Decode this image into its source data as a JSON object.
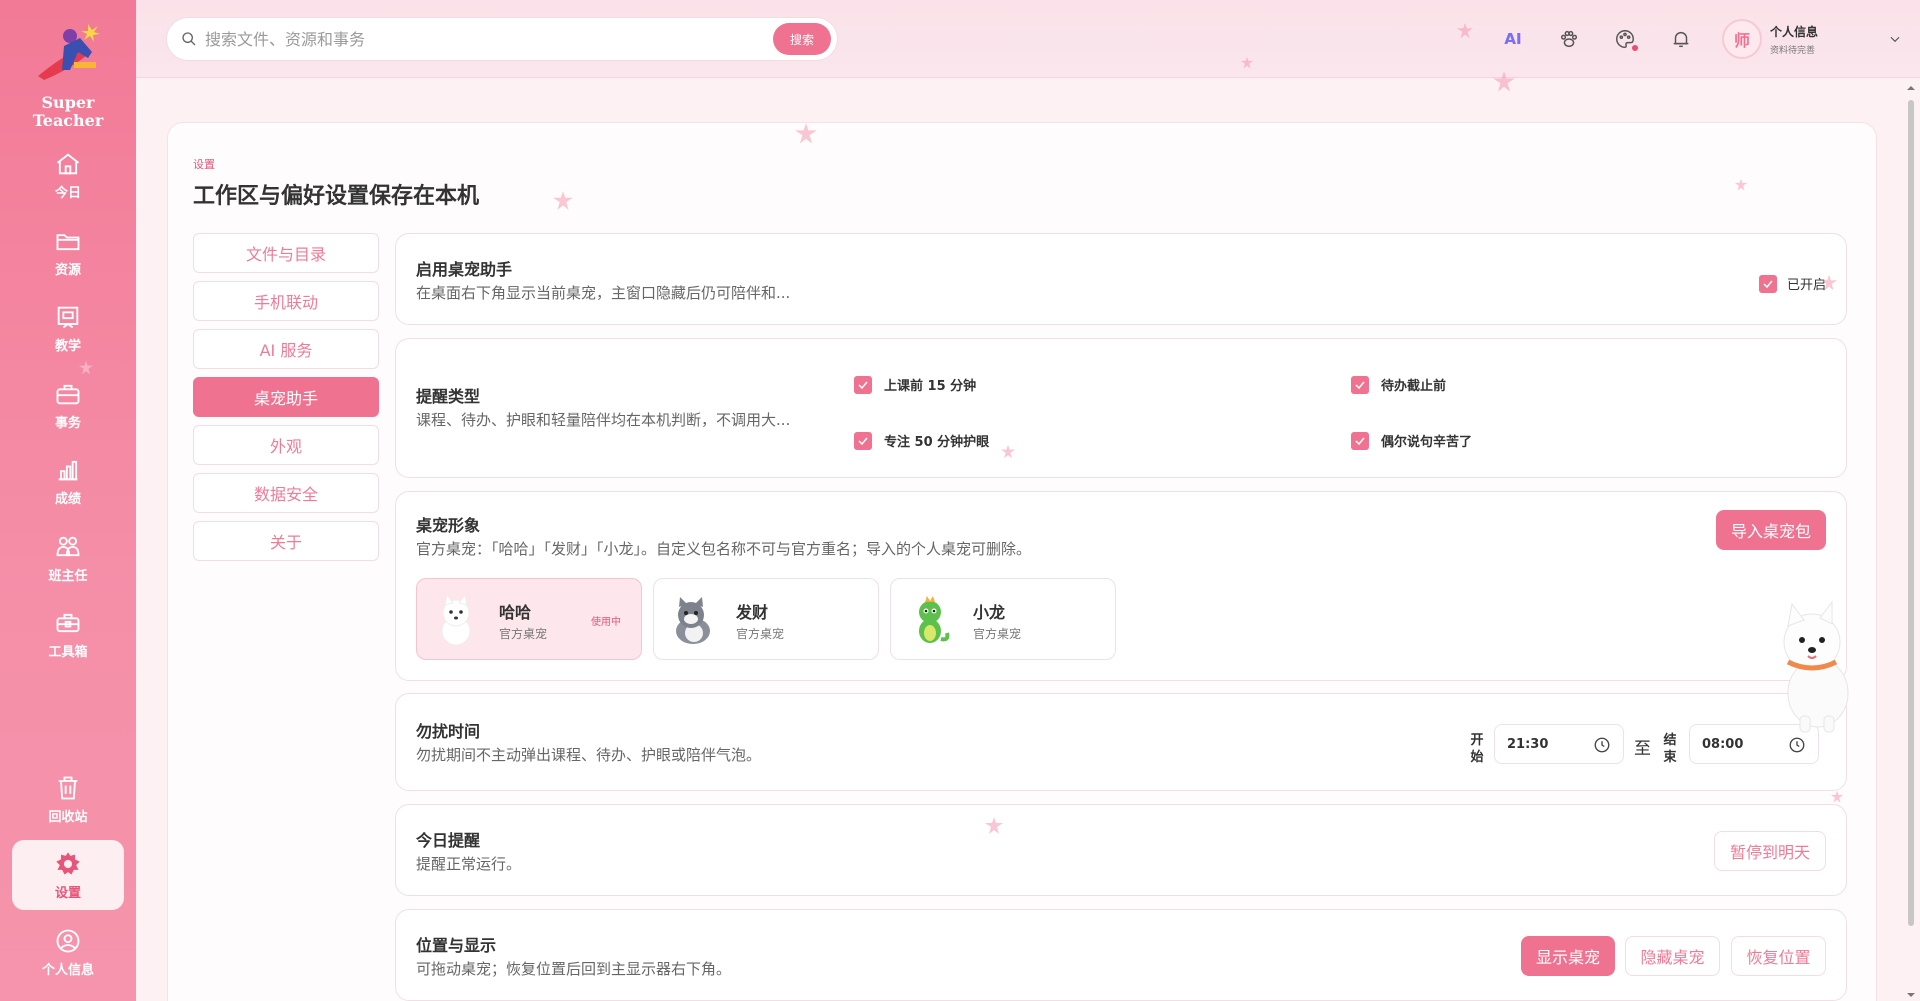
{
  "app": {
    "brand": "Super Teacher"
  },
  "sidebar": {
    "items": [
      {
        "label": "今日",
        "icon": "home-icon"
      },
      {
        "label": "资源",
        "icon": "folder-icon"
      },
      {
        "label": "教学",
        "icon": "teaching-icon"
      },
      {
        "label": "事务",
        "icon": "briefcase-icon"
      },
      {
        "label": "成绩",
        "icon": "bar-chart-icon"
      },
      {
        "label": "班主任",
        "icon": "group-icon"
      },
      {
        "label": "工具箱",
        "icon": "toolbox-icon"
      }
    ],
    "bottom": [
      {
        "label": "回收站",
        "icon": "trash-icon"
      },
      {
        "label": "设置",
        "icon": "gear-icon",
        "active": true
      },
      {
        "label": "个人信息",
        "icon": "user-icon"
      }
    ]
  },
  "topbar": {
    "search_placeholder": "搜索文件、资源和事务",
    "search_button": "搜索",
    "ai_label": "AI",
    "profile_avatar": "师",
    "profile_name": "个人信息",
    "profile_sub": "资料待完善"
  },
  "page": {
    "crumb": "设置",
    "title": "工作区与偏好设置保存在本机"
  },
  "subnav": {
    "items": [
      "文件与目录",
      "手机联动",
      "AI 服务",
      "桌宠助手",
      "外观",
      "数据安全",
      "关于"
    ],
    "active": "桌宠助手"
  },
  "sections": {
    "enable": {
      "title": "启用桌宠助手",
      "desc": "在桌面右下角显示当前桌宠，主窗口隐藏后仍可陪伴和...",
      "toggle_label": "已开启"
    },
    "reminders": {
      "title": "提醒类型",
      "desc": "课程、待办、护眼和轻量陪伴均在本机判断，不调用大...",
      "options": [
        "上课前 15 分钟",
        "待办截止前",
        "专注 50 分钟护眼",
        "偶尔说句辛苦了"
      ]
    },
    "appearance": {
      "title": "桌宠形象",
      "desc": "官方桌宠：「哈哈」「发财」「小龙」。自定义包名称不可与官方重名；导入的个人桌宠可删除。",
      "import_button": "导入桌宠包",
      "pets": [
        {
          "name": "哈哈",
          "sub": "官方桌宠",
          "badge": "使用中"
        },
        {
          "name": "发财",
          "sub": "官方桌宠",
          "badge": ""
        },
        {
          "name": "小龙",
          "sub": "官方桌宠",
          "badge": ""
        }
      ]
    },
    "dnd": {
      "title": "勿扰时间",
      "desc": "勿扰期间不主动弹出课程、待办、护眼或陪伴气泡。",
      "start_label": "开始",
      "start_time": "21:30",
      "to_label": "至",
      "end_label": "结束",
      "end_time": "08:00"
    },
    "today": {
      "title": "今日提醒",
      "desc": "提醒正常运行。",
      "pause_button": "暂停到明天"
    },
    "position": {
      "title": "位置与显示",
      "desc": "可拖动桌宠；恢复位置后回到主显示器右下角。",
      "show_button": "显示桌宠",
      "hide_button": "隐藏桌宠",
      "reset_button": "恢复位置"
    }
  },
  "colors": {
    "accent": "#ef7391",
    "sidebar": "#f27a97",
    "background": "#fdf1f4"
  }
}
